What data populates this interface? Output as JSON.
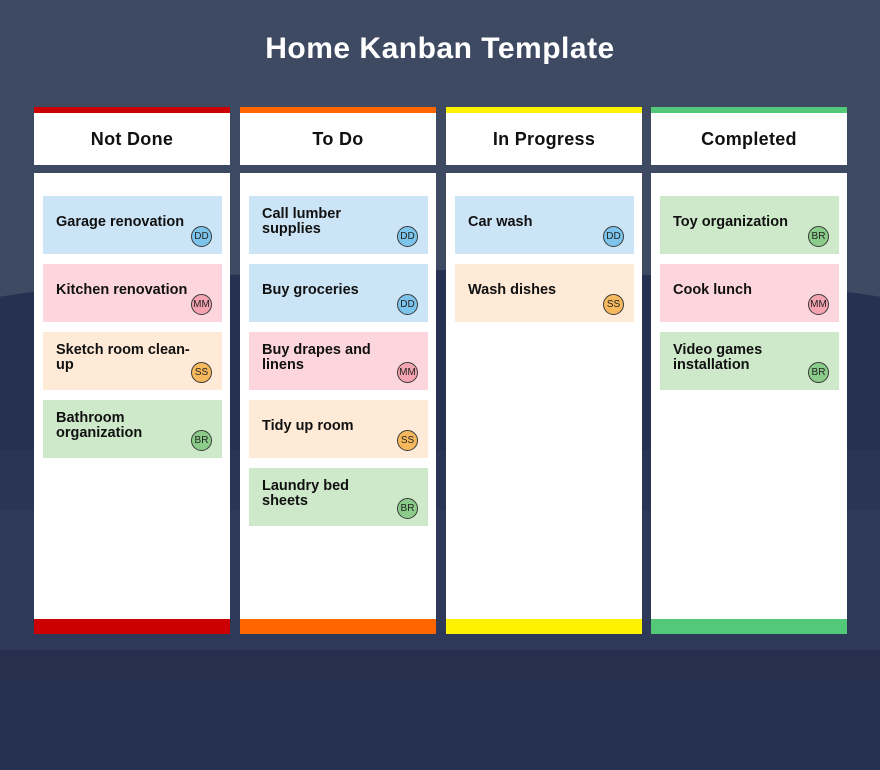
{
  "title": "Home Kanban Template",
  "card_colors": {
    "blue": "#cce5f6",
    "pink": "#fdd5dc",
    "peach": "#feead6",
    "green": "#cde9c9"
  },
  "assignees": {
    "DD": {
      "initials": "DD",
      "color": "#7cc4ec"
    },
    "MM": {
      "initials": "MM",
      "color": "#f4a4b0"
    },
    "SS": {
      "initials": "SS",
      "color": "#f7b95d"
    },
    "BR": {
      "initials": "BR",
      "color": "#8ccc8a"
    }
  },
  "columns": [
    {
      "label": "Not Done",
      "accent": "#cc0000",
      "cards": [
        {
          "text": "Garage renovation",
          "assignee": "DD",
          "color": "blue"
        },
        {
          "text": "Kitchen renovation",
          "assignee": "MM",
          "color": "pink"
        },
        {
          "text": "Sketch room clean-up",
          "assignee": "SS",
          "color": "peach"
        },
        {
          "text": "Bathroom organization",
          "assignee": "BR",
          "color": "green"
        }
      ]
    },
    {
      "label": "To Do",
      "accent": "#ff6600",
      "cards": [
        {
          "text": "Call lumber supplies",
          "assignee": "DD",
          "color": "blue"
        },
        {
          "text": "Buy groceries",
          "assignee": "DD",
          "color": "blue"
        },
        {
          "text": "Buy drapes and linens",
          "assignee": "MM",
          "color": "pink"
        },
        {
          "text": "Tidy up room",
          "assignee": "SS",
          "color": "peach"
        },
        {
          "text": "Laundry bed sheets",
          "assignee": "BR",
          "color": "green"
        }
      ]
    },
    {
      "label": "In Progress",
      "accent": "#fff200",
      "cards": [
        {
          "text": "Car wash",
          "assignee": "DD",
          "color": "blue"
        },
        {
          "text": "Wash dishes",
          "assignee": "SS",
          "color": "peach"
        }
      ]
    },
    {
      "label": "Completed",
      "accent": "#52c878",
      "cards": [
        {
          "text": "Toy organization",
          "assignee": "BR",
          "color": "green"
        },
        {
          "text": "Cook lunch",
          "assignee": "MM",
          "color": "pink"
        },
        {
          "text": "Video games installation",
          "assignee": "BR",
          "color": "green"
        }
      ]
    }
  ]
}
